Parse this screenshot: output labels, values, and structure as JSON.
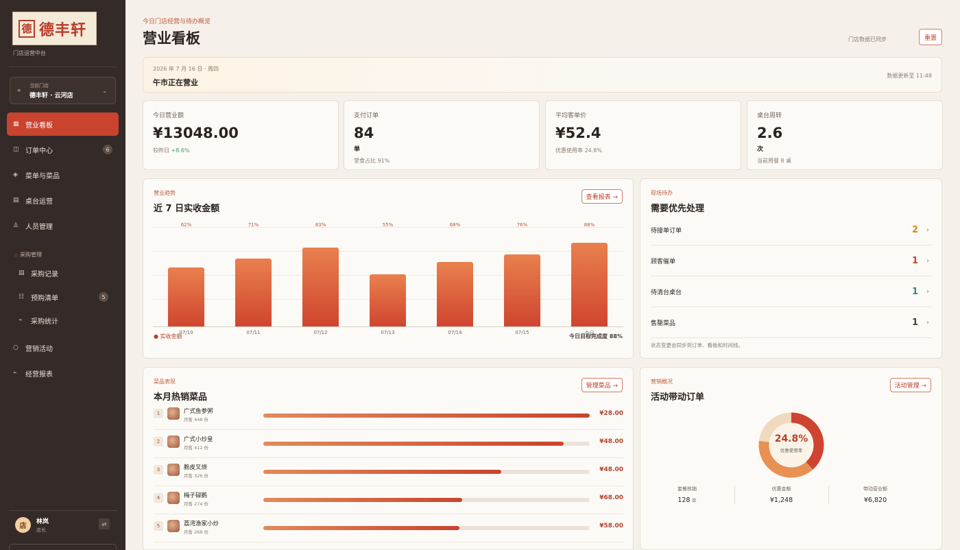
{
  "sidebar": {
    "logo_seal": "德",
    "logo_text": "德丰轩",
    "platform": "门店运营中台",
    "store_label": "当前门店",
    "store_name": "德丰轩 · 云河店",
    "nav": [
      {
        "label": "营业看板",
        "active": true,
        "icon": "dashboard-icon"
      },
      {
        "label": "订单中心",
        "badge": "6",
        "icon": "order-icon"
      },
      {
        "label": "菜单与菜品",
        "icon": "menu-icon"
      },
      {
        "label": "桌台运营",
        "icon": "table-icon"
      },
      {
        "label": "人员管理",
        "icon": "user-icon"
      }
    ],
    "section_purchase": "采购管理",
    "sub": [
      {
        "label": "采购记录",
        "icon": "record-icon"
      },
      {
        "label": "预购清单",
        "badge": "5",
        "icon": "list-icon"
      },
      {
        "label": "采购统计",
        "icon": "stats-icon"
      }
    ],
    "nav2": [
      {
        "label": "营销活动",
        "icon": "marketing-icon"
      },
      {
        "label": "经营报表",
        "icon": "report-icon"
      }
    ],
    "user": {
      "avatar": "店",
      "name": "林岚",
      "role": "店长"
    }
  },
  "header": {
    "crumb": "今日门店经营与待办概览",
    "title": "营业看板",
    "sync": "门店数据已同步",
    "reset": "重置"
  },
  "banner": {
    "date": "2026 年 7 月 16 日 · 周四",
    "status": "午市正在营业",
    "updated": "数据更新至 11:48"
  },
  "kpis": [
    {
      "label": "今日营业额",
      "value": "¥13048.00",
      "foot_prefix": "较昨日 ",
      "foot_up": "+8.6%"
    },
    {
      "label": "支付订单",
      "value": "84",
      "unit": "单",
      "foot": "堂食占比 91%"
    },
    {
      "label": "平均客单价",
      "value": "¥52.4",
      "foot": "优惠使用率 24.8%"
    },
    {
      "label": "桌台周转",
      "value": "2.6",
      "unit": "次",
      "foot": "当前用餐 8 桌"
    }
  ],
  "trend": {
    "small": "营业趋势",
    "title": "近 7 日实收金额",
    "button": "查看报表 →",
    "legend": "实收金额",
    "target_label": "今日目标完成度",
    "target_value": "88%"
  },
  "chart_data": {
    "type": "bar",
    "categories": [
      "07/10",
      "07/11",
      "07/12",
      "07/13",
      "07/14",
      "07/15",
      "今日"
    ],
    "series": [
      {
        "name": "实收金额",
        "values": [
          62,
          71,
          83,
          55,
          68,
          76,
          88
        ]
      }
    ],
    "labels": [
      "62%",
      "71%",
      "83%",
      "55%",
      "68%",
      "76%",
      "88%"
    ],
    "ylim": [
      0,
      100
    ],
    "grid": true,
    "legend": "bottom-left"
  },
  "todo": {
    "small": "现场待办",
    "title": "需要优先处理",
    "items": [
      {
        "label": "待接单订单",
        "count": "2",
        "color": "#d98a1c"
      },
      {
        "label": "顾客催单",
        "count": "1",
        "color": "#c9432e"
      },
      {
        "label": "待清台桌台",
        "count": "1",
        "color": "#2f8a7e"
      },
      {
        "label": "售罄菜品",
        "count": "1",
        "color": "#4a403b"
      }
    ],
    "note": "状态变更会同步到订单、看板和时间线。"
  },
  "dishes": {
    "small": "菜品表现",
    "title": "本月热销菜品",
    "button": "管理菜品 →",
    "items": [
      {
        "rank": "1",
        "name": "广式鱼参粥",
        "sales": "月售 448 份",
        "price": "¥28.00",
        "ratio": 1.0
      },
      {
        "rank": "2",
        "name": "广式小炒皇",
        "sales": "月售 412 份",
        "price": "¥48.00",
        "ratio": 0.92
      },
      {
        "rank": "3",
        "name": "脆皮叉烧",
        "sales": "月售 326 份",
        "price": "¥48.00",
        "ratio": 0.73
      },
      {
        "rank": "4",
        "name": "梅子碌鹅",
        "sales": "月售 274 份",
        "price": "¥68.00",
        "ratio": 0.61
      },
      {
        "rank": "5",
        "name": "荔湾渔家小炒",
        "sales": "月售 268 份",
        "price": "¥58.00",
        "ratio": 0.6
      }
    ]
  },
  "marketing": {
    "small": "营销概况",
    "title": "活动带动订单",
    "button": "活动管理 →",
    "donut_value": "24.8%",
    "donut_label": "优惠使用率",
    "donut_segments": [
      {
        "fraction": 0.385,
        "color": "#cf4331"
      },
      {
        "fraction": 0.385,
        "color": "#e89152"
      },
      {
        "fraction": 0.23,
        "color": "#f0d9bd"
      }
    ],
    "stats": [
      {
        "label": "套餐核销",
        "value": "128",
        "unit": " 单"
      },
      {
        "label": "优惠金额",
        "value": "¥1,248",
        "unit": ""
      },
      {
        "label": "带动营业额",
        "value": "¥6,820",
        "unit": ""
      }
    ]
  }
}
